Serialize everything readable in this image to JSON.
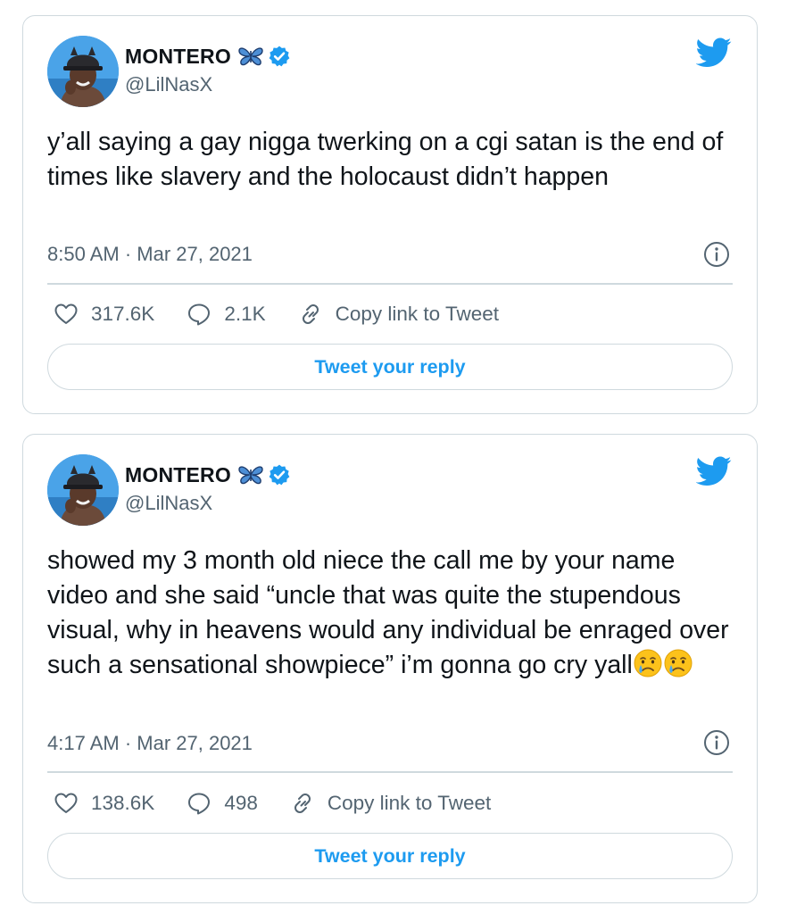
{
  "colors": {
    "accent": "#1d9bf0",
    "text_primary": "#0f1419",
    "text_secondary": "#536471",
    "border": "#cfd9de"
  },
  "tweets": [
    {
      "author": {
        "display_name": "MONTERO",
        "name_emoji": "butterfly-icon",
        "verified": true,
        "handle": "@LilNasX"
      },
      "text": "y’all saying a gay nigga twerking on a cgi satan is the end of times like slavery and the holocaust didn’t happen",
      "timestamp": "8:50 AM · Mar 27, 2021",
      "likes": "317.6K",
      "replies": "2.1K",
      "copy_link_label": "Copy link to Tweet",
      "reply_button_label": "Tweet your reply"
    },
    {
      "author": {
        "display_name": "MONTERO",
        "name_emoji": "butterfly-icon",
        "verified": true,
        "handle": "@LilNasX"
      },
      "text": "showed my 3 month old niece the call me by your name video and she said “uncle that was quite the stupendous visual, why in heavens would any individual be enraged over such a sensational showpiece” i’m gonna go cry yall",
      "text_emojis": [
        "crying-face-emoji",
        "crying-face-emoji"
      ],
      "timestamp": "4:17 AM · Mar 27, 2021",
      "likes": "138.6K",
      "replies": "498",
      "copy_link_label": "Copy link to Tweet",
      "reply_button_label": "Tweet your reply"
    }
  ]
}
